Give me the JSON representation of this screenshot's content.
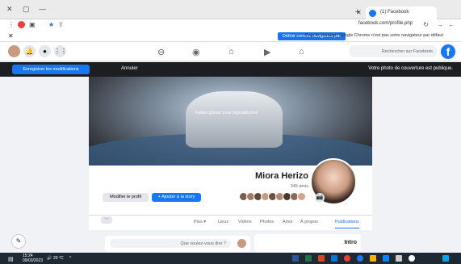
{
  "browser": {
    "tab_title": "(1) Facebook",
    "new_tab": "+",
    "url": "facebook.com/profile.php",
    "info_message": "Pour le moment, Google Chrome n'est pas votre navigateur par défaut",
    "info_button": "Définir comme navigateur par défaut"
  },
  "facebook": {
    "logo": "f",
    "search_placeholder": "Rechercher sur Facebook",
    "announcement": "Votre photo de couverture est publique.",
    "save_button": "Enregistrer les modifications",
    "cancel_button": "Annuler",
    "cover_button": "Faites glisser pour repositionner"
  },
  "profile": {
    "name": "Miora Herizo",
    "friends": "345 amis",
    "add_story": "+ Ajouter à la story",
    "edit_profile": "Modifier le profil",
    "tabs": [
      "Publications",
      "À propos",
      "Amis",
      "Photos",
      "Vidéos",
      "Lieux",
      "Plus ▾"
    ],
    "more": "···"
  },
  "feed": {
    "intro_title": "Intro",
    "composer_placeholder": "Que voulez-vous dire ?"
  },
  "taskbar": {
    "weather": "20 °C",
    "time": "15:24",
    "date": "09/03/2023"
  },
  "colors": {
    "accent": "#1877f2",
    "background": "#f0f2f5",
    "dark_strip": "#1c1e21"
  }
}
